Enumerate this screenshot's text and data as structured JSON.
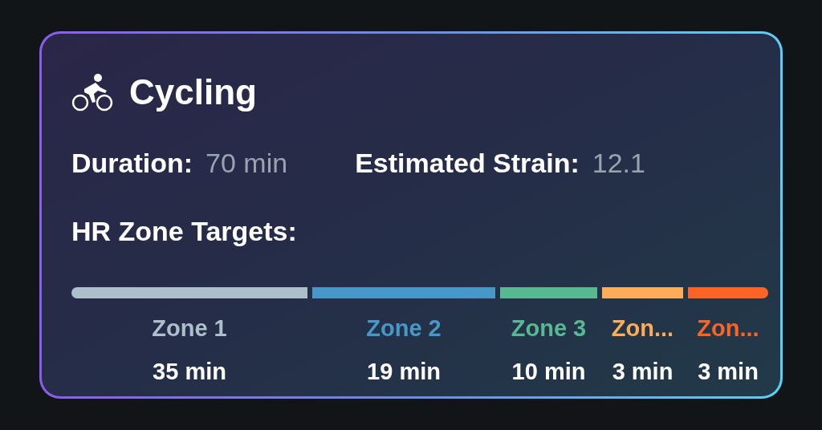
{
  "card": {
    "title": "Cycling",
    "stats": [
      {
        "label": "Duration:",
        "value": "70 min"
      },
      {
        "label": "Estimated Strain:",
        "value": "12.1"
      }
    ],
    "zones_heading": "HR Zone Targets:",
    "zones": [
      {
        "name": "Zone 1",
        "time": "35 min",
        "color": "#aebfcc"
      },
      {
        "name": "Zone 2",
        "time": "19 min",
        "color": "#4798c8"
      },
      {
        "name": "Zone 3",
        "time": "10 min",
        "color": "#58b891"
      },
      {
        "name": "Zon...",
        "time": "3 min",
        "color": "#fdac5a"
      },
      {
        "name": "Zon...",
        "time": "3 min",
        "color": "#fc6426"
      }
    ]
  }
}
